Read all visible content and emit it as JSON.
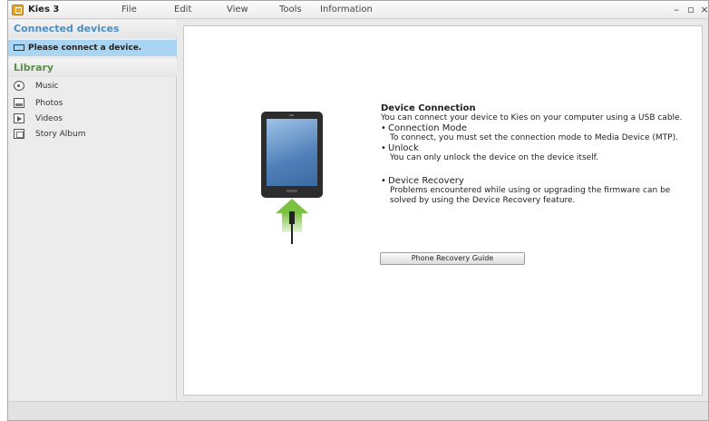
{
  "app": {
    "title": "Kies 3"
  },
  "menu": [
    "File",
    "Edit",
    "View",
    "Tools",
    "Information"
  ],
  "window_controls": {
    "minimize": "–",
    "maximize": "▫",
    "close": "×"
  },
  "sidebar": {
    "connected_header": "Connected devices",
    "device_item": "Please connect a device.",
    "library_header": "Library",
    "library_items": [
      {
        "label": "Music",
        "icon": "music-icon"
      },
      {
        "label": "Photos",
        "icon": "photos-icon"
      },
      {
        "label": "Videos",
        "icon": "videos-icon"
      },
      {
        "label": "Story Album",
        "icon": "story-album-icon"
      }
    ]
  },
  "main": {
    "title": "Device Connection",
    "intro": "You can connect your device to Kies on your computer using a USB cable.",
    "bullets": [
      {
        "head": "Connection Mode",
        "text": "To connect, you must set the connection mode to Media Device (MTP)."
      },
      {
        "head": "Unlock",
        "text": "You can only unlock the device on the device itself."
      },
      {
        "head": "Device Recovery",
        "text": "Problems encountered while using or upgrading the firmware can be solved by using the Device Recovery feature."
      }
    ],
    "recovery_button": "Phone Recovery Guide"
  },
  "colors": {
    "accent_blue": "#4a8fc4",
    "selected_bg": "#a9d5f2",
    "arrow_green": "#7bc142"
  }
}
